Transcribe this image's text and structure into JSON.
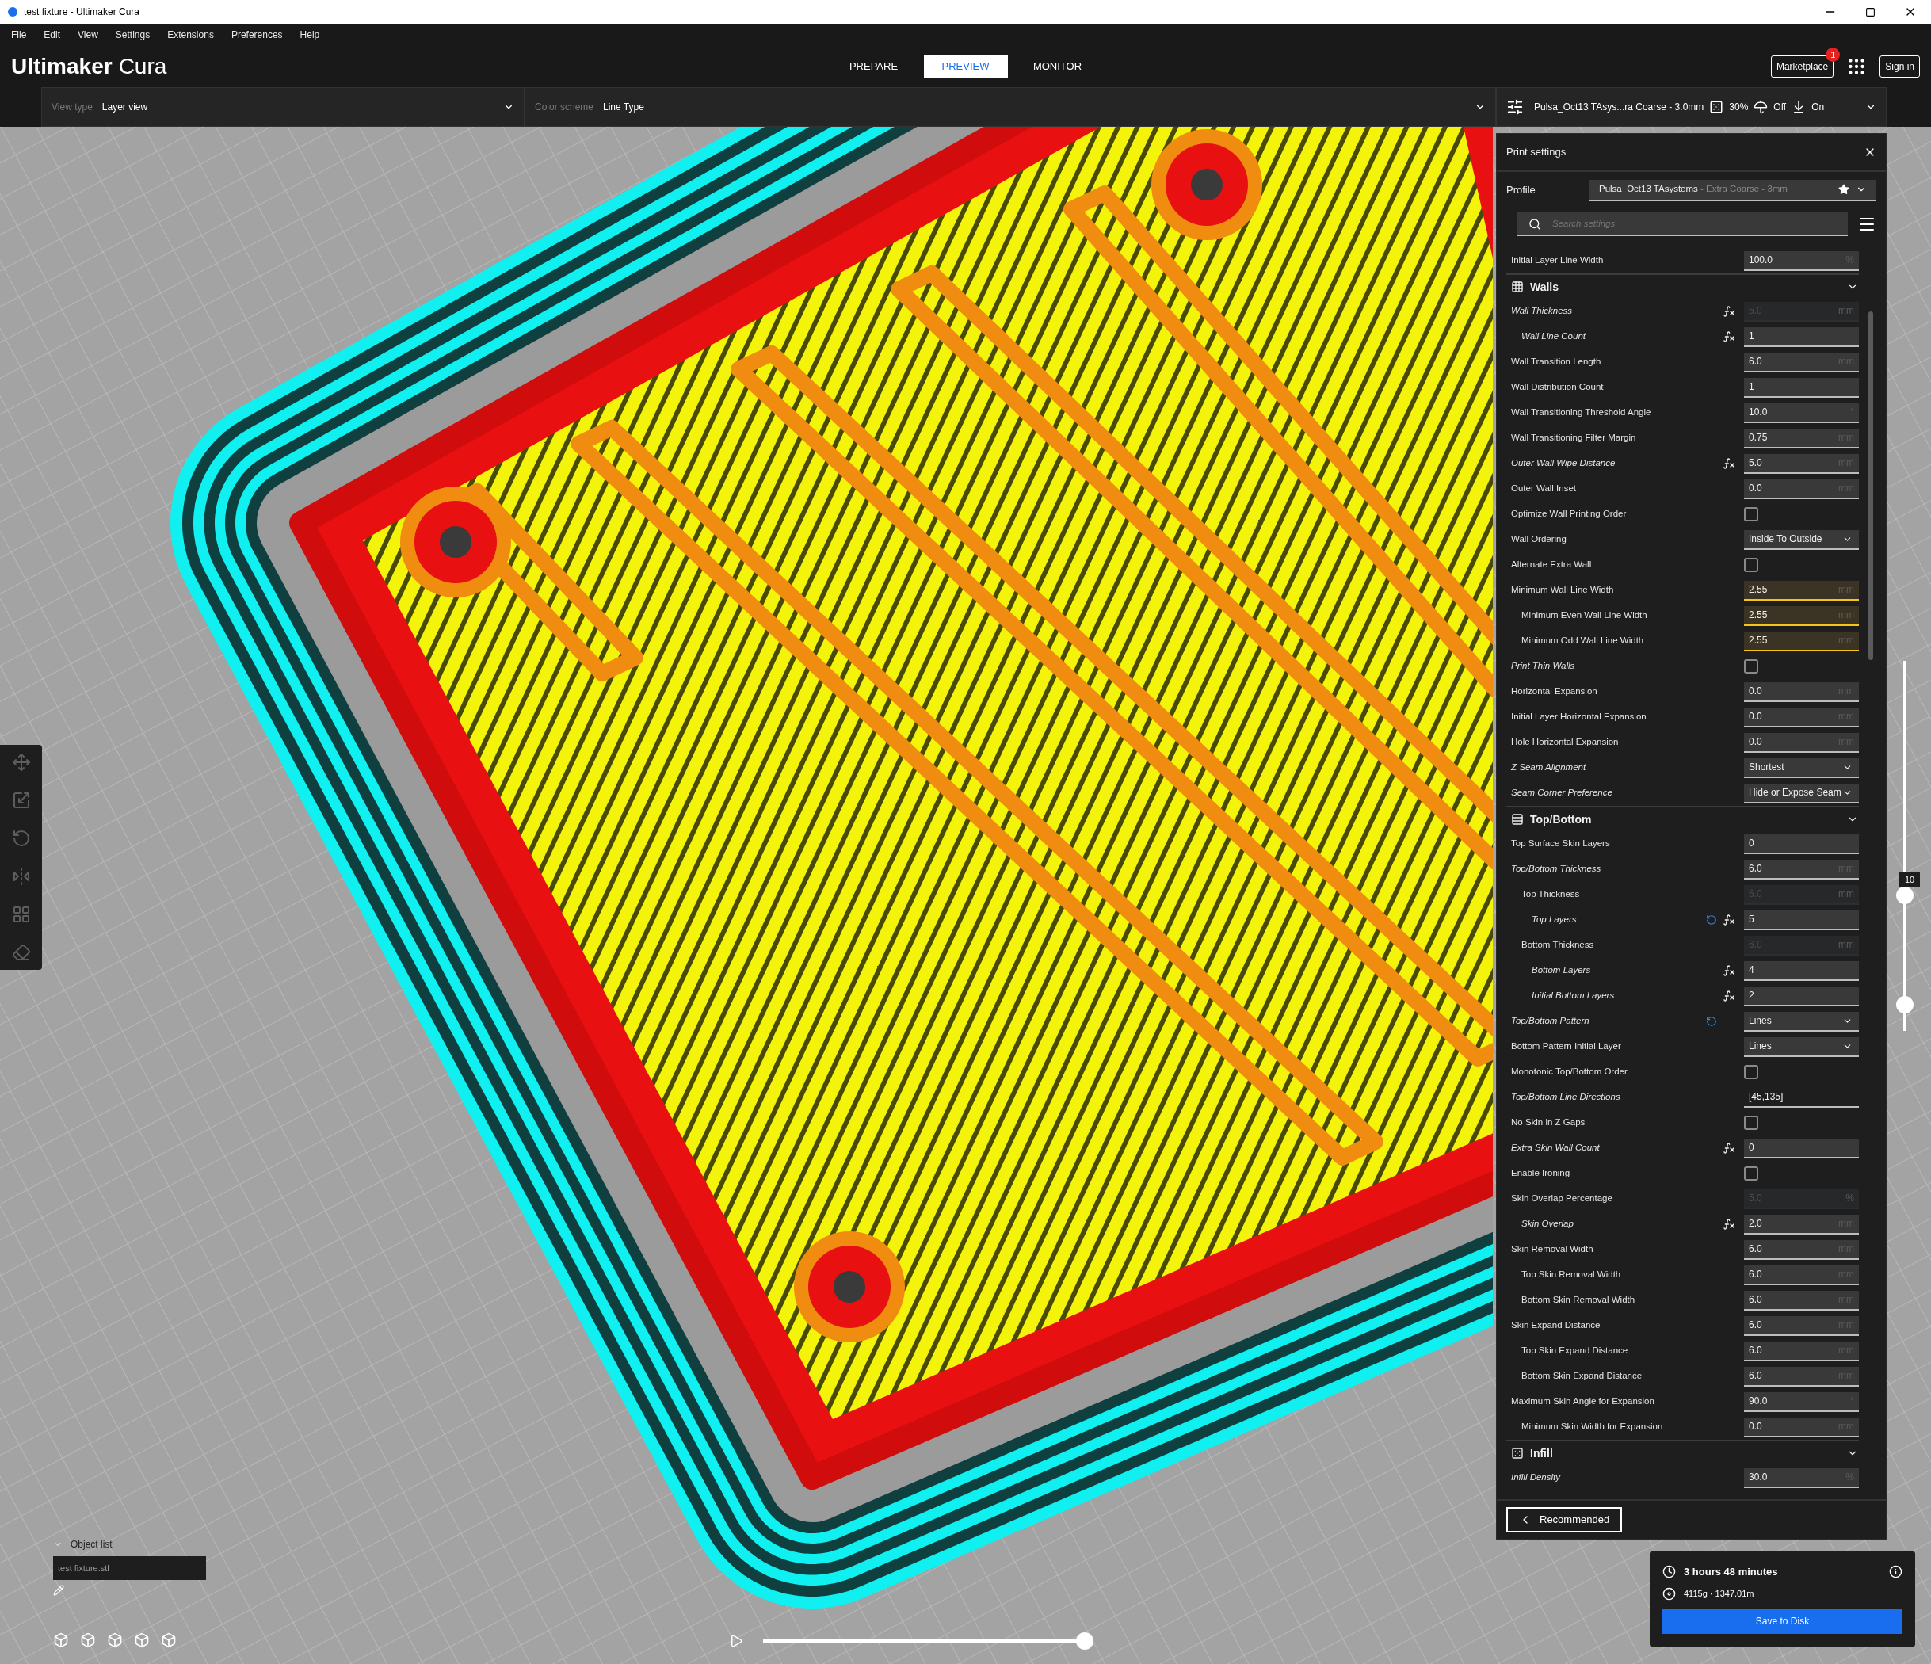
{
  "window": {
    "title": "test fixture - Ultimaker Cura"
  },
  "menu": [
    "File",
    "Edit",
    "View",
    "Settings",
    "Extensions",
    "Preferences",
    "Help"
  ],
  "header": {
    "brand": "Ultimaker",
    "product": "Cura",
    "tabs": [
      {
        "label": "PREPARE",
        "selected": false
      },
      {
        "label": "PREVIEW",
        "selected": true
      },
      {
        "label": "MONITOR",
        "selected": false
      }
    ],
    "marketplace": "Marketplace",
    "badge": "1",
    "sign_in": "Sign in"
  },
  "stage_bar": {
    "view_type_label": "View type",
    "view_type": "Layer view",
    "color_scheme_label": "Color scheme",
    "color_scheme": "Line Type",
    "setup": {
      "profile": "Pulsa_Oct13 TAsys...ra Coarse - 3.0mm",
      "infill": "30%",
      "support": "Off",
      "adhesion": "On"
    }
  },
  "settings_panel": {
    "title": "Print settings",
    "profile_label": "Profile",
    "profile_name": "Pulsa_Oct13 TAsystems",
    "profile_detail": " - Extra Coarse - 3mm",
    "search": {
      "placeholder": "Search settings"
    },
    "footer_button": "Recommended",
    "items": [
      {
        "kind": "number",
        "label": "Initial Layer Line Width",
        "value": "100.0",
        "unit": "%"
      },
      {
        "kind": "section",
        "label": "Walls",
        "expanded": true,
        "children": [
          {
            "kind": "number",
            "label": "Wall Thickness",
            "value": "5.0",
            "unit": "mm",
            "profile_set": true,
            "inherits": true,
            "disabled": true,
            "children": [
              {
                "kind": "number",
                "label": "Wall Line Count",
                "value": "1",
                "profile_set": true,
                "inherits": true
              }
            ]
          },
          {
            "kind": "number",
            "label": "Wall Transition Length",
            "value": "6.0",
            "unit": "mm"
          },
          {
            "kind": "number",
            "label": "Wall Distribution Count",
            "value": "1"
          },
          {
            "kind": "number",
            "label": "Wall Transitioning Threshold Angle",
            "value": "10.0",
            "unit": "°"
          },
          {
            "kind": "number",
            "label": "Wall Transitioning Filter Margin",
            "value": "0.75",
            "unit": "mm"
          },
          {
            "kind": "number",
            "label": "Outer Wall Wipe Distance",
            "value": "5.0",
            "unit": "mm",
            "profile_set": true,
            "inherits": true
          },
          {
            "kind": "number",
            "label": "Outer Wall Inset",
            "value": "0.0",
            "unit": "mm"
          },
          {
            "kind": "checkbox",
            "label": "Optimize Wall Printing Order",
            "checked": false
          },
          {
            "kind": "dropdown",
            "label": "Wall Ordering",
            "value": "Inside To Outside"
          },
          {
            "kind": "checkbox",
            "label": "Alternate Extra Wall",
            "checked": false
          },
          {
            "kind": "number",
            "label": "Minimum Wall Line Width",
            "value": "2.55",
            "unit": "mm",
            "warning": true,
            "children": [
              {
                "kind": "number",
                "label": "Minimum Even Wall Line Width",
                "value": "2.55",
                "unit": "mm",
                "warning": true
              },
              {
                "kind": "number",
                "label": "Minimum Odd Wall Line Width",
                "value": "2.55",
                "unit": "mm",
                "warning": true
              }
            ]
          },
          {
            "kind": "checkbox",
            "label": "Print Thin Walls",
            "checked": false,
            "profile_set": true
          },
          {
            "kind": "number",
            "label": "Horizontal Expansion",
            "value": "0.0",
            "unit": "mm"
          },
          {
            "kind": "number",
            "label": "Initial Layer Horizontal Expansion",
            "value": "0.0",
            "unit": "mm"
          },
          {
            "kind": "number",
            "label": "Hole Horizontal Expansion",
            "value": "0.0",
            "unit": "mm"
          },
          {
            "kind": "dropdown",
            "label": "Z Seam Alignment",
            "value": "Shortest",
            "profile_set": true
          },
          {
            "kind": "dropdown",
            "label": "Seam Corner Preference",
            "value": "Hide or Expose Seam",
            "profile_set": true
          }
        ]
      },
      {
        "kind": "section",
        "label": "Top/Bottom",
        "expanded": true,
        "children": [
          {
            "kind": "number",
            "label": "Top Surface Skin Layers",
            "value": "0"
          },
          {
            "kind": "number",
            "label": "Top/Bottom Thickness",
            "value": "6.0",
            "unit": "mm",
            "profile_set": true,
            "children": [
              {
                "kind": "number",
                "label": "Top Thickness",
                "value": "6.0",
                "unit": "mm",
                "disabled": true,
                "children": [
                  {
                    "kind": "number",
                    "label": "Top Layers",
                    "value": "5",
                    "profile_set": true,
                    "inherits": true,
                    "resettable": true
                  }
                ]
              },
              {
                "kind": "number",
                "label": "Bottom Thickness",
                "value": "6.0",
                "unit": "mm",
                "disabled": true,
                "children": [
                  {
                    "kind": "number",
                    "label": "Bottom Layers",
                    "value": "4",
                    "profile_set": true,
                    "inherits": true
                  },
                  {
                    "kind": "number",
                    "label": "Initial Bottom Layers",
                    "value": "2",
                    "profile_set": true,
                    "inherits": true
                  }
                ]
              }
            ]
          },
          {
            "kind": "dropdown",
            "label": "Top/Bottom Pattern",
            "value": "Lines",
            "profile_set": true,
            "resettable": true
          },
          {
            "kind": "dropdown",
            "label": "Bottom Pattern Initial Layer",
            "value": "Lines"
          },
          {
            "kind": "checkbox",
            "label": "Monotonic Top/Bottom Order",
            "checked": false
          },
          {
            "kind": "text",
            "label": "Top/Bottom Line Directions",
            "value": "[45,135]",
            "profile_set": true
          },
          {
            "kind": "checkbox",
            "label": "No Skin in Z Gaps",
            "checked": false
          },
          {
            "kind": "number",
            "label": "Extra Skin Wall Count",
            "value": "0",
            "profile_set": true,
            "inherits": true
          },
          {
            "kind": "checkbox",
            "label": "Enable Ironing",
            "checked": false
          },
          {
            "kind": "number",
            "label": "Skin Overlap Percentage",
            "value": "5.0",
            "unit": "%",
            "disabled": true,
            "children": [
              {
                "kind": "number",
                "label": "Skin Overlap",
                "value": "2.0",
                "unit": "mm",
                "profile_set": true,
                "inherits": true
              }
            ]
          },
          {
            "kind": "number",
            "label": "Skin Removal Width",
            "value": "6.0",
            "unit": "mm",
            "children": [
              {
                "kind": "number",
                "label": "Top Skin Removal Width",
                "value": "6.0",
                "unit": "mm"
              },
              {
                "kind": "number",
                "label": "Bottom Skin Removal Width",
                "value": "6.0",
                "unit": "mm"
              }
            ]
          },
          {
            "kind": "number",
            "label": "Skin Expand Distance",
            "value": "6.0",
            "unit": "mm",
            "children": [
              {
                "kind": "number",
                "label": "Top Skin Expand Distance",
                "value": "6.0",
                "unit": "mm"
              },
              {
                "kind": "number",
                "label": "Bottom Skin Expand Distance",
                "value": "6.0",
                "unit": "mm"
              }
            ]
          },
          {
            "kind": "number",
            "label": "Maximum Skin Angle for Expansion",
            "value": "90.0",
            "unit": "°",
            "children": [
              {
                "kind": "number",
                "label": "Minimum Skin Width for Expansion",
                "value": "0.0",
                "unit": "mm"
              }
            ]
          }
        ]
      },
      {
        "kind": "section",
        "label": "Infill",
        "expanded": true,
        "children": [
          {
            "kind": "number",
            "label": "Infill Density",
            "value": "30.0",
            "unit": "%",
            "profile_set": true
          }
        ]
      }
    ]
  },
  "layer_slider": {
    "label": "10",
    "handles": [
      {
        "level": 0.36
      },
      {
        "level": 0.05
      }
    ]
  },
  "object_list": {
    "title": "Object list",
    "expanded": true,
    "objects": [
      "test fixture.stl"
    ]
  },
  "timeline": {
    "level": 1.0
  },
  "action_panel": {
    "time": "3 hours 48 minutes",
    "material": "4115g · 1347.01m",
    "button": "Save to Disk"
  }
}
